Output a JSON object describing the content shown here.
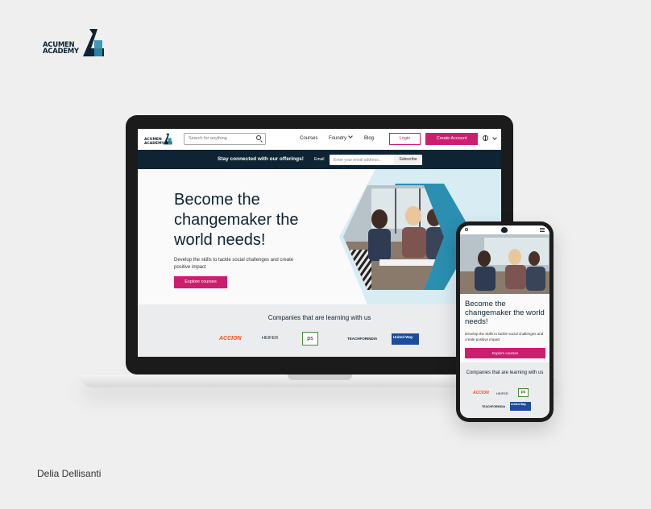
{
  "brand": {
    "line1": "ACUMEN",
    "line2": "ACADEMY"
  },
  "credit": "Delia Dellisanti",
  "desktop": {
    "nav": {
      "search_placeholder": "Search for anything",
      "links": [
        "Courses",
        "Foundry",
        "Blog"
      ],
      "login_label": "Login",
      "create_label": "Create Account",
      "globe_icon": "globe-icon"
    },
    "banner": {
      "text": "Stay connected with our offerings!",
      "email_label": "Email",
      "email_placeholder": "Enter your email address...",
      "subscribe_label": "Subscribe"
    },
    "hero": {
      "title": "Become the changemaker the world needs!",
      "description": "Develop the skills to tackle social challenges and create positive impact",
      "cta_label": "Explore courses"
    },
    "partners": {
      "title": "Companies that are learning with us",
      "logos": [
        "ACCION",
        "HEIFER",
        "ps",
        "TEACHFORINDIA",
        "United Way"
      ]
    }
  },
  "mobile": {
    "hero": {
      "title": "Become the changemaker the world needs!",
      "description": "Develop the skills to tackle social challenges and create positive impact",
      "cta_label": "Explore courses"
    },
    "partners": {
      "title": "Companies that are learning with us"
    }
  },
  "colors": {
    "navy": "#0e2433",
    "accent": "#cc1e6f",
    "teal": "#2a8fb0",
    "light_blue": "#d8ecf3"
  }
}
